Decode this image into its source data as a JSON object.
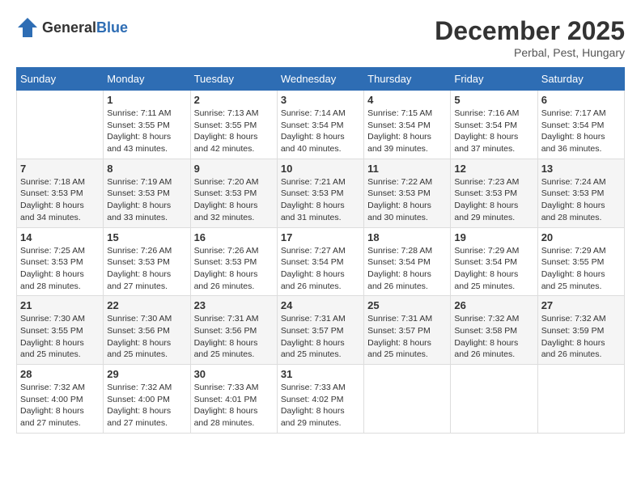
{
  "header": {
    "logo_general": "General",
    "logo_blue": "Blue",
    "month": "December 2025",
    "location": "Perbal, Pest, Hungary"
  },
  "days_of_week": [
    "Sunday",
    "Monday",
    "Tuesday",
    "Wednesday",
    "Thursday",
    "Friday",
    "Saturday"
  ],
  "weeks": [
    [
      {
        "day": "",
        "info": ""
      },
      {
        "day": "1",
        "info": "Sunrise: 7:11 AM\nSunset: 3:55 PM\nDaylight: 8 hours\nand 43 minutes."
      },
      {
        "day": "2",
        "info": "Sunrise: 7:13 AM\nSunset: 3:55 PM\nDaylight: 8 hours\nand 42 minutes."
      },
      {
        "day": "3",
        "info": "Sunrise: 7:14 AM\nSunset: 3:54 PM\nDaylight: 8 hours\nand 40 minutes."
      },
      {
        "day": "4",
        "info": "Sunrise: 7:15 AM\nSunset: 3:54 PM\nDaylight: 8 hours\nand 39 minutes."
      },
      {
        "day": "5",
        "info": "Sunrise: 7:16 AM\nSunset: 3:54 PM\nDaylight: 8 hours\nand 37 minutes."
      },
      {
        "day": "6",
        "info": "Sunrise: 7:17 AM\nSunset: 3:54 PM\nDaylight: 8 hours\nand 36 minutes."
      }
    ],
    [
      {
        "day": "7",
        "info": "Sunrise: 7:18 AM\nSunset: 3:53 PM\nDaylight: 8 hours\nand 34 minutes."
      },
      {
        "day": "8",
        "info": "Sunrise: 7:19 AM\nSunset: 3:53 PM\nDaylight: 8 hours\nand 33 minutes."
      },
      {
        "day": "9",
        "info": "Sunrise: 7:20 AM\nSunset: 3:53 PM\nDaylight: 8 hours\nand 32 minutes."
      },
      {
        "day": "10",
        "info": "Sunrise: 7:21 AM\nSunset: 3:53 PM\nDaylight: 8 hours\nand 31 minutes."
      },
      {
        "day": "11",
        "info": "Sunrise: 7:22 AM\nSunset: 3:53 PM\nDaylight: 8 hours\nand 30 minutes."
      },
      {
        "day": "12",
        "info": "Sunrise: 7:23 AM\nSunset: 3:53 PM\nDaylight: 8 hours\nand 29 minutes."
      },
      {
        "day": "13",
        "info": "Sunrise: 7:24 AM\nSunset: 3:53 PM\nDaylight: 8 hours\nand 28 minutes."
      }
    ],
    [
      {
        "day": "14",
        "info": "Sunrise: 7:25 AM\nSunset: 3:53 PM\nDaylight: 8 hours\nand 28 minutes."
      },
      {
        "day": "15",
        "info": "Sunrise: 7:26 AM\nSunset: 3:53 PM\nDaylight: 8 hours\nand 27 minutes."
      },
      {
        "day": "16",
        "info": "Sunrise: 7:26 AM\nSunset: 3:53 PM\nDaylight: 8 hours\nand 26 minutes."
      },
      {
        "day": "17",
        "info": "Sunrise: 7:27 AM\nSunset: 3:54 PM\nDaylight: 8 hours\nand 26 minutes."
      },
      {
        "day": "18",
        "info": "Sunrise: 7:28 AM\nSunset: 3:54 PM\nDaylight: 8 hours\nand 26 minutes."
      },
      {
        "day": "19",
        "info": "Sunrise: 7:29 AM\nSunset: 3:54 PM\nDaylight: 8 hours\nand 25 minutes."
      },
      {
        "day": "20",
        "info": "Sunrise: 7:29 AM\nSunset: 3:55 PM\nDaylight: 8 hours\nand 25 minutes."
      }
    ],
    [
      {
        "day": "21",
        "info": "Sunrise: 7:30 AM\nSunset: 3:55 PM\nDaylight: 8 hours\nand 25 minutes."
      },
      {
        "day": "22",
        "info": "Sunrise: 7:30 AM\nSunset: 3:56 PM\nDaylight: 8 hours\nand 25 minutes."
      },
      {
        "day": "23",
        "info": "Sunrise: 7:31 AM\nSunset: 3:56 PM\nDaylight: 8 hours\nand 25 minutes."
      },
      {
        "day": "24",
        "info": "Sunrise: 7:31 AM\nSunset: 3:57 PM\nDaylight: 8 hours\nand 25 minutes."
      },
      {
        "day": "25",
        "info": "Sunrise: 7:31 AM\nSunset: 3:57 PM\nDaylight: 8 hours\nand 25 minutes."
      },
      {
        "day": "26",
        "info": "Sunrise: 7:32 AM\nSunset: 3:58 PM\nDaylight: 8 hours\nand 26 minutes."
      },
      {
        "day": "27",
        "info": "Sunrise: 7:32 AM\nSunset: 3:59 PM\nDaylight: 8 hours\nand 26 minutes."
      }
    ],
    [
      {
        "day": "28",
        "info": "Sunrise: 7:32 AM\nSunset: 4:00 PM\nDaylight: 8 hours\nand 27 minutes."
      },
      {
        "day": "29",
        "info": "Sunrise: 7:32 AM\nSunset: 4:00 PM\nDaylight: 8 hours\nand 27 minutes."
      },
      {
        "day": "30",
        "info": "Sunrise: 7:33 AM\nSunset: 4:01 PM\nDaylight: 8 hours\nand 28 minutes."
      },
      {
        "day": "31",
        "info": "Sunrise: 7:33 AM\nSunset: 4:02 PM\nDaylight: 8 hours\nand 29 minutes."
      },
      {
        "day": "",
        "info": ""
      },
      {
        "day": "",
        "info": ""
      },
      {
        "day": "",
        "info": ""
      }
    ]
  ]
}
